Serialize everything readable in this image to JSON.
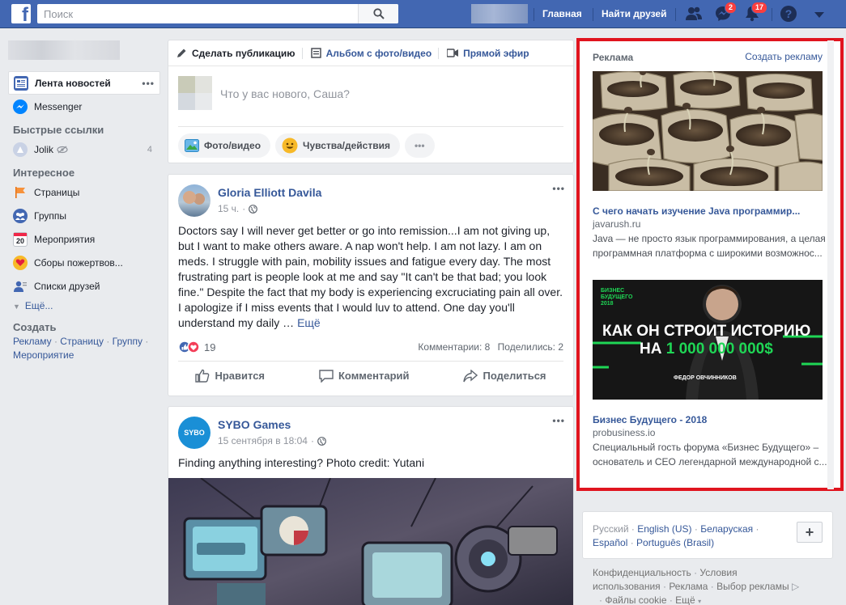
{
  "topbar": {
    "logo": "f",
    "search_placeholder": "Поиск",
    "home_label": "Главная",
    "find_friends_label": "Найти друзей",
    "messenger_badge": "2",
    "notifications_badge": "17",
    "brand_color": "#4267b2"
  },
  "sidebar": {
    "news_feed": "Лента новостей",
    "messenger": "Messenger",
    "quick_links_head": "Быстрые ссылки",
    "quick_links": [
      {
        "label": "Jolik",
        "count": "4"
      }
    ],
    "interests_head": "Интересное",
    "interests": [
      {
        "label": "Страницы",
        "icon": "flag-icon"
      },
      {
        "label": "Группы",
        "icon": "groups-icon"
      },
      {
        "label": "Мероприятия",
        "icon": "calendar-icon",
        "day": "20"
      },
      {
        "label": "Сборы пожертвов...",
        "icon": "fundraiser-icon"
      },
      {
        "label": "Списки друзей",
        "icon": "friend-lists-icon"
      }
    ],
    "more": "Ещё...",
    "create_head": "Создать",
    "create_links": [
      "Рекламу",
      "Страницу",
      "Группу",
      "Мероприятие"
    ]
  },
  "composer": {
    "tabs": [
      "Сделать публикацию",
      "Альбом с фото/видео",
      "Прямой эфир"
    ],
    "placeholder": "Что у вас нового, Саша?",
    "buttons": [
      "Фото/видео",
      "Чувства/действия"
    ]
  },
  "posts": [
    {
      "author": "Gloria Elliott Davila",
      "time": "15 ч.",
      "text": "Doctors say I will never get better or go into remission...I am not giving up, but I want to make others aware. A nap won't help. I am not lazy. I am on meds. I struggle with pain, mobility issues and fatigue every day. The most frustrating part is people look at me and say \"It can't be that bad; you look fine.\" Despite the fact that my body is experiencing excruciating pain all over. I apologize if I miss events that I would luv to attend. One day you'll understand my daily …",
      "more": "Ещё",
      "reactions": "19",
      "comments": "Комментарии: 8",
      "shares": "Поделились: 2",
      "actions": [
        "Нравится",
        "Комментарий",
        "Поделиться"
      ]
    },
    {
      "author": "SYBO Games",
      "avatar_text": "SYBO",
      "time": "15 сентября в 18:04",
      "text": "Finding anything interesting? Photo credit: Yutani"
    }
  ],
  "ads": {
    "head": "Реклама",
    "create": "Создать рекламу",
    "items": [
      {
        "title": "С чего начать изучение Java программир...",
        "domain": "javarush.ru",
        "desc": "Java — не просто язык программирования, а целая программная платформа с широкими возможнос..."
      },
      {
        "title": "Бизнес Будущего - 2018",
        "domain": "probusiness.io",
        "desc": "Специальный гость форума «Бизнес Будущего» – основатель и CEO легендарной международной с...",
        "banner_badge": "БИЗНЕС БУДУЩЕГО 2018",
        "banner_line1": "КАК ОН СТРОИТ ИСТОРИЮ",
        "banner_line2_prefix": "НА",
        "banner_line2_amount": "1 000 000 000$",
        "banner_person": "ФЕДОР ОВЧИННИКОВ"
      }
    ],
    "highlight_color": "#e0141e"
  },
  "languages": {
    "row1": [
      "Русский",
      "English (US)",
      "Беларуская"
    ],
    "row2": [
      "Español",
      "Português (Brasil)"
    ]
  },
  "footer": {
    "row1": [
      "Конфиденциальность",
      "Условия"
    ],
    "row2": [
      "использования",
      "Реклама",
      "Выбор рекламы"
    ],
    "row3": [
      "Файлы cookie",
      "Ещё"
    ]
  }
}
